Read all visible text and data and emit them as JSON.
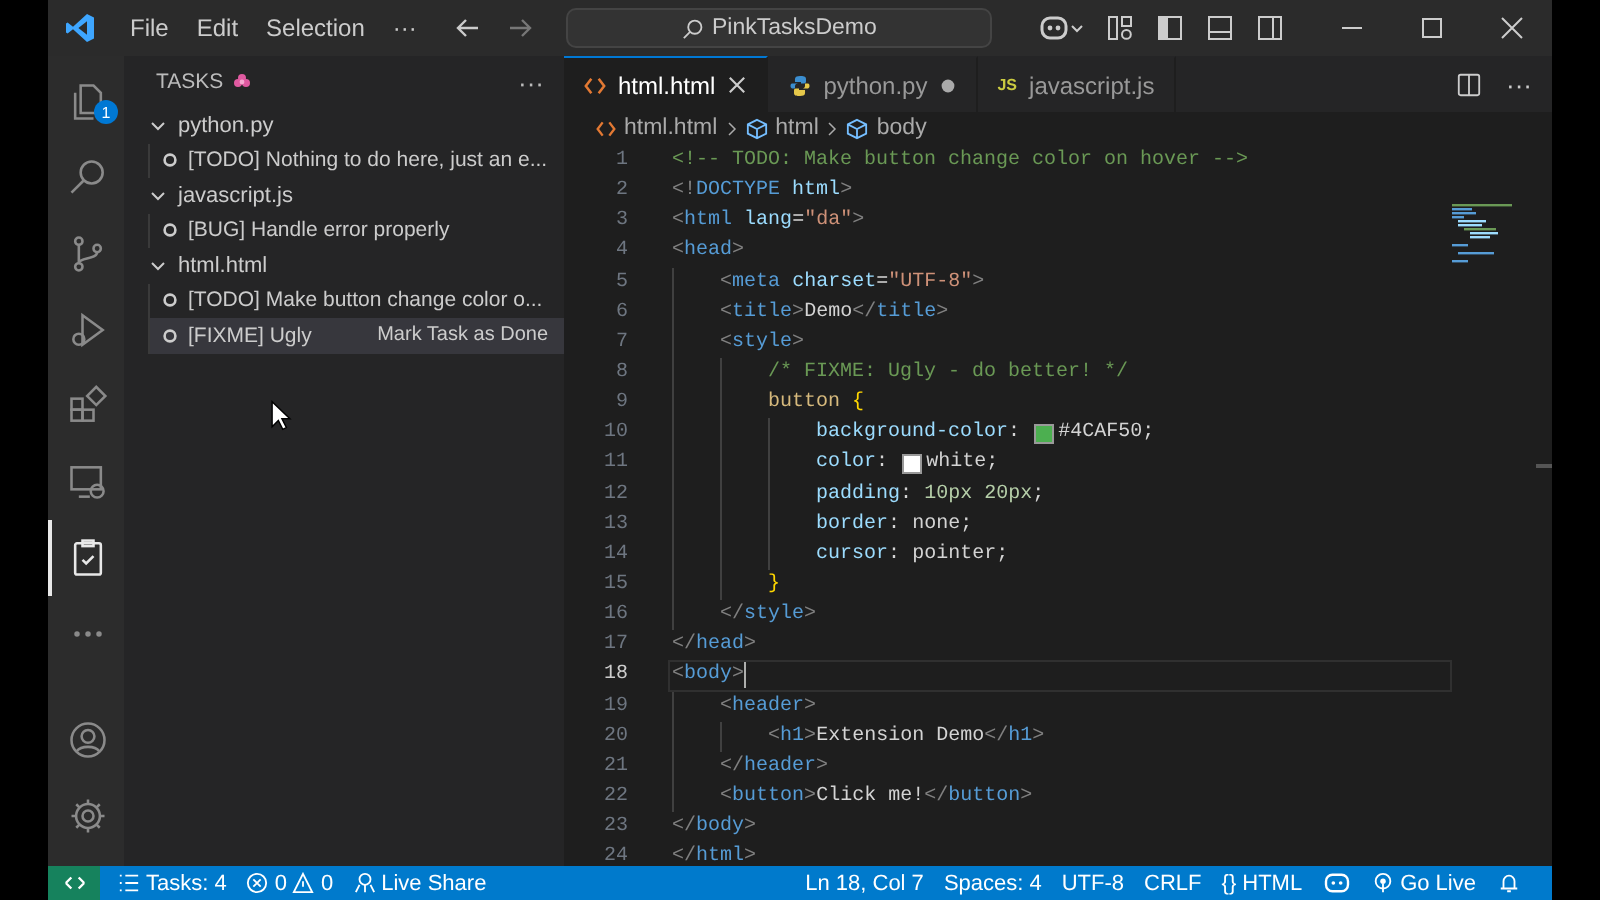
{
  "title_bar": {
    "menus": [
      "File",
      "Edit",
      "Selection"
    ],
    "more": "···",
    "search": "PinkTasksDemo"
  },
  "activity_bar": {
    "top": [
      {
        "kind": "explorer",
        "selected": false,
        "badge": "1"
      },
      {
        "kind": "search",
        "selected": false
      },
      {
        "kind": "source-control",
        "selected": false
      },
      {
        "kind": "run",
        "selected": false
      },
      {
        "kind": "extensions",
        "selected": false
      },
      {
        "kind": "remote",
        "selected": false
      },
      {
        "kind": "tasks",
        "selected": true
      },
      {
        "kind": "more",
        "selected": false
      }
    ],
    "bottom": [
      {
        "kind": "account",
        "selected": false
      },
      {
        "kind": "settings",
        "selected": false
      }
    ]
  },
  "sidebar": {
    "title": "TASKS",
    "more": "···",
    "groups": [
      {
        "label": "python.py",
        "expanded": true,
        "children": [
          {
            "text": "[TODO] Nothing to do here, just an e...",
            "selected": false
          }
        ]
      },
      {
        "label": "javascript.js",
        "expanded": true,
        "children": [
          {
            "text": "[BUG] Handle error properly",
            "selected": false
          }
        ]
      },
      {
        "label": "html.html",
        "expanded": true,
        "children": [
          {
            "text": "[TODO] Make button change color o...",
            "selected": false
          },
          {
            "text": "[FIXME] Ugly",
            "selected": true,
            "action": "Mark Task as Done"
          }
        ]
      }
    ]
  },
  "tabs": [
    {
      "label": "html.html",
      "kind": "html",
      "selected": true,
      "modified": false
    },
    {
      "label": "python.py",
      "kind": "python",
      "selected": false,
      "modified": true
    },
    {
      "label": "javascript.js",
      "kind": "js",
      "icon": "JS",
      "selected": false,
      "modified": false
    }
  ],
  "tabs_more": "···",
  "breadcrumb": [
    "html.html",
    "html",
    "body"
  ],
  "editor": {
    "lines": [
      {
        "n": "1",
        "current": false,
        "code": "<!-- TODO: Make button change color on hover -->"
      },
      {
        "n": "2",
        "current": false,
        "code": "<!DOCTYPE html>"
      },
      {
        "n": "3",
        "current": false,
        "code": "<html lang=\"da\">"
      },
      {
        "n": "4",
        "current": false,
        "code": "<head>"
      },
      {
        "n": "5",
        "current": false,
        "code": "    <meta charset=\"UTF-8\">"
      },
      {
        "n": "6",
        "current": false,
        "code": "    <title>Demo</title>"
      },
      {
        "n": "7",
        "current": false,
        "code": "    <style>"
      },
      {
        "n": "8",
        "current": false,
        "code": "        /* FIXME: Ugly - do better! */"
      },
      {
        "n": "9",
        "current": false,
        "code": "        button {"
      },
      {
        "n": "10",
        "current": false,
        "code": "            background-color: ",
        "color": "#4caf50",
        "after": "#4CAF50;"
      },
      {
        "n": "11",
        "current": false,
        "code": "            color: ",
        "color": "#ffffff",
        "after": "white;"
      },
      {
        "n": "12",
        "current": false,
        "code": "            padding: 10px 20px;"
      },
      {
        "n": "13",
        "current": false,
        "code": "            border: none;"
      },
      {
        "n": "14",
        "current": false,
        "code": "            cursor: pointer;"
      },
      {
        "n": "15",
        "current": false,
        "code": "        }"
      },
      {
        "n": "16",
        "current": false,
        "code": "    </style>"
      },
      {
        "n": "17",
        "current": false,
        "code": "</head>"
      },
      {
        "n": "18",
        "current": true,
        "code": "<body>"
      },
      {
        "n": "19",
        "current": false,
        "code": "    <header>"
      },
      {
        "n": "20",
        "current": false,
        "code": "        <h1>Extension Demo</h1>"
      },
      {
        "n": "21",
        "current": false,
        "code": "    </header>"
      },
      {
        "n": "22",
        "current": false,
        "code": "    <button>Click me!</button>"
      },
      {
        "n": "23",
        "current": false,
        "code": "</body>"
      },
      {
        "n": "24",
        "current": false,
        "code": "</html>"
      }
    ]
  },
  "status_bar": {
    "tasks": "Tasks: 4",
    "errors": "0",
    "warnings": "0",
    "live_share": "Live Share",
    "position": "Ln 18, Col 7",
    "spaces": "Spaces: 4",
    "encoding": "UTF-8",
    "eol": "CRLF",
    "braces": "{}",
    "language": "HTML",
    "go_live": "Go Live"
  }
}
